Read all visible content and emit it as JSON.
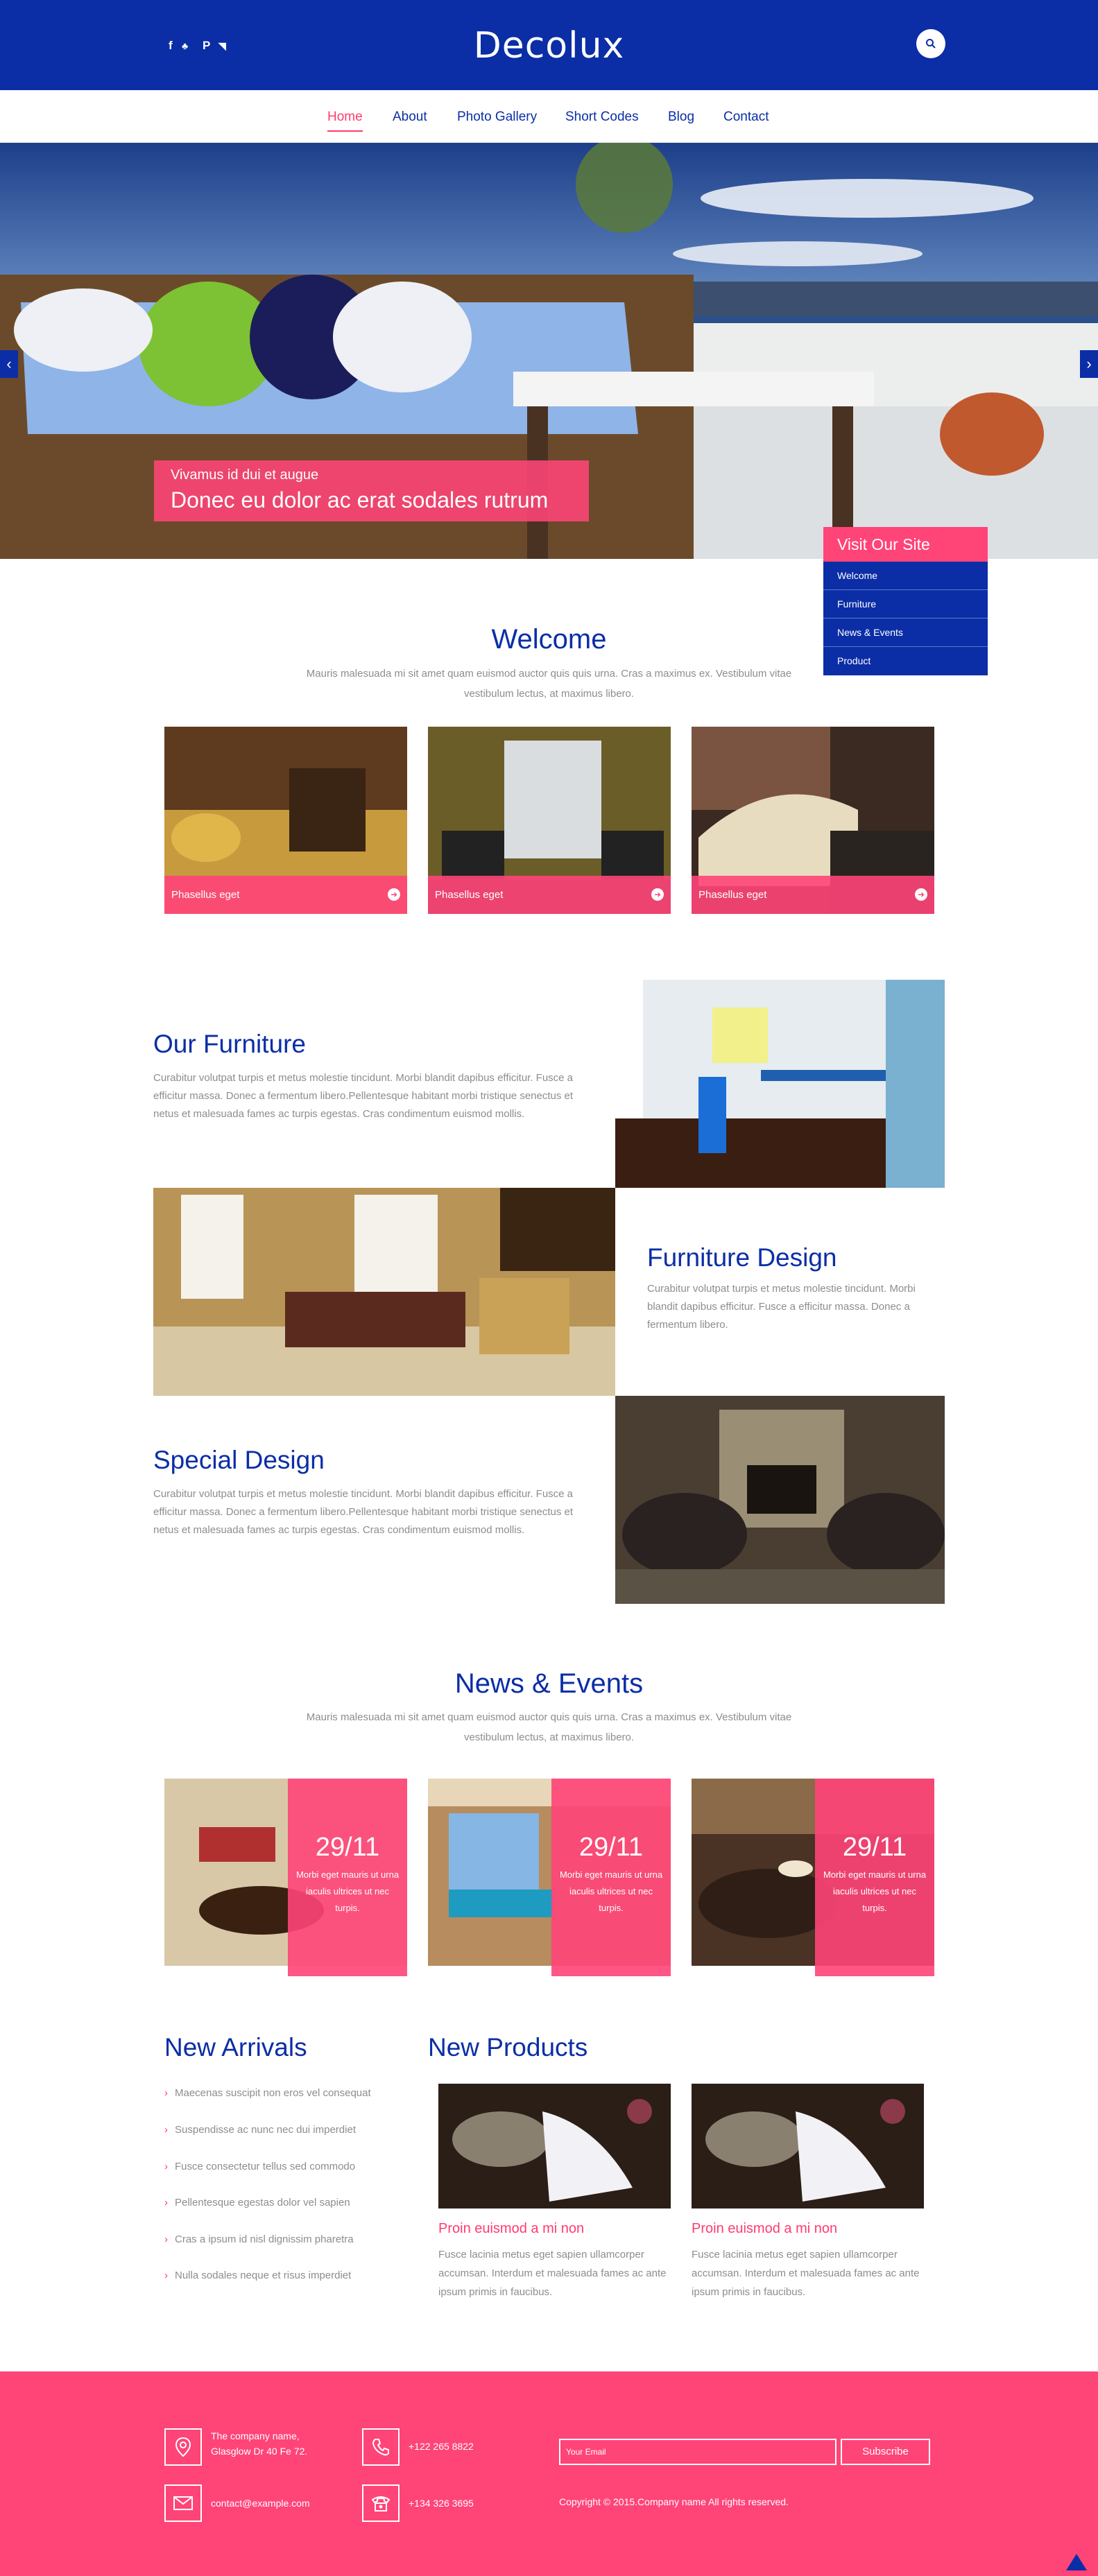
{
  "header": {
    "logo": "Decolux",
    "social_icons": [
      "facebook-icon",
      "twitter-icon",
      "pinterest-icon",
      "rss-icon"
    ],
    "social_glyphs": [
      "f",
      "♣",
      "P",
      "◥"
    ],
    "search_icon": "search-icon"
  },
  "nav": {
    "items": [
      "Home",
      "About",
      "Photo Gallery",
      "Short Codes",
      "Blog",
      "Contact"
    ],
    "active": "Home"
  },
  "hero": {
    "caption_small": "Vivamus id dui et augue",
    "caption_big": "Donec eu dolor ac erat sodales rutrum",
    "prev_glyph": "‹",
    "next_glyph": "›"
  },
  "visit_box": {
    "title": "Visit Our Site",
    "items": [
      "Welcome",
      "Furniture",
      "News & Events",
      "Product"
    ]
  },
  "welcome": {
    "title": "Welcome",
    "description": "Mauris malesuada mi sit amet quam euismod auctor quis quis urna. Cras a maximus ex. Vestibulum vitae vestibulum lectus, at maximus libero.",
    "tiles": [
      {
        "label": "Phasellus eget"
      },
      {
        "label": "Phasellus eget"
      },
      {
        "label": "Phasellus eget"
      }
    ]
  },
  "furniture": [
    {
      "title": "Our Furniture",
      "text": "Curabitur volutpat turpis et metus molestie tincidunt. Morbi blandit dapibus efficitur. Fusce a efficitur massa. Donec a fermentum libero.Pellentesque habitant morbi tristique senectus et netus et malesuada fames ac turpis egestas. Cras condimentum euismod mollis."
    },
    {
      "title": "Furniture Design",
      "text": "Curabitur volutpat turpis et metus molestie tincidunt. Morbi blandit dapibus efficitur. Fusce a efficitur massa. Donec a fermentum libero."
    },
    {
      "title": "Special Design",
      "text": "Curabitur volutpat turpis et metus molestie tincidunt. Morbi blandit dapibus efficitur. Fusce a efficitur massa. Donec a fermentum libero.Pellentesque habitant morbi tristique senectus et netus et malesuada fames ac turpis egestas. Cras condimentum euismod mollis."
    }
  ],
  "news": {
    "title": "News & Events",
    "description": "Mauris malesuada mi sit amet quam euismod auctor quis quis urna. Cras a maximus ex. Vestibulum vitae vestibulum lectus, at maximus libero.",
    "items": [
      {
        "date": "29/11",
        "text": "Morbi eget mauris ut urna iaculis ultrices ut nec turpis."
      },
      {
        "date": "29/11",
        "text": "Morbi eget mauris ut urna iaculis ultrices ut nec turpis."
      },
      {
        "date": "29/11",
        "text": "Morbi eget mauris ut urna iaculis ultrices ut nec turpis."
      }
    ]
  },
  "arrivals": {
    "title": "New Arrivals",
    "items": [
      "Maecenas suscipit non eros vel consequat",
      "Suspendisse ac nunc nec dui imperdiet",
      "Fusce consectetur tellus sed commodo",
      "Pellentesque egestas dolor vel sapien",
      "Cras a ipsum id nisl dignissim pharetra",
      "Nulla sodales neque et risus imperdiet"
    ]
  },
  "products": {
    "title": "New Products",
    "items": [
      {
        "title": "Proin euismod a mi non",
        "text": "Fusce lacinia metus eget sapien ullamcorper accumsan. Interdum et malesuada fames ac ante ipsum primis in faucibus."
      },
      {
        "title": "Proin euismod a mi non",
        "text": "Fusce lacinia metus eget sapien ullamcorper accumsan. Interdum et malesuada fames ac ante ipsum primis in faucibus."
      }
    ]
  },
  "footer": {
    "address": "The company name, Glasglow Dr 40 Fe 72.",
    "phone1": "+122 265 8822",
    "email": "contact@example.com",
    "phone2": "+134 326 3695",
    "email_placeholder": "Your Email",
    "subscribe": "Subscribe",
    "copyright": "Copyright © 2015.Company name All rights reserved."
  },
  "colors": {
    "brand_blue": "#0b2ea6",
    "accent_pink": "#ff4478"
  }
}
